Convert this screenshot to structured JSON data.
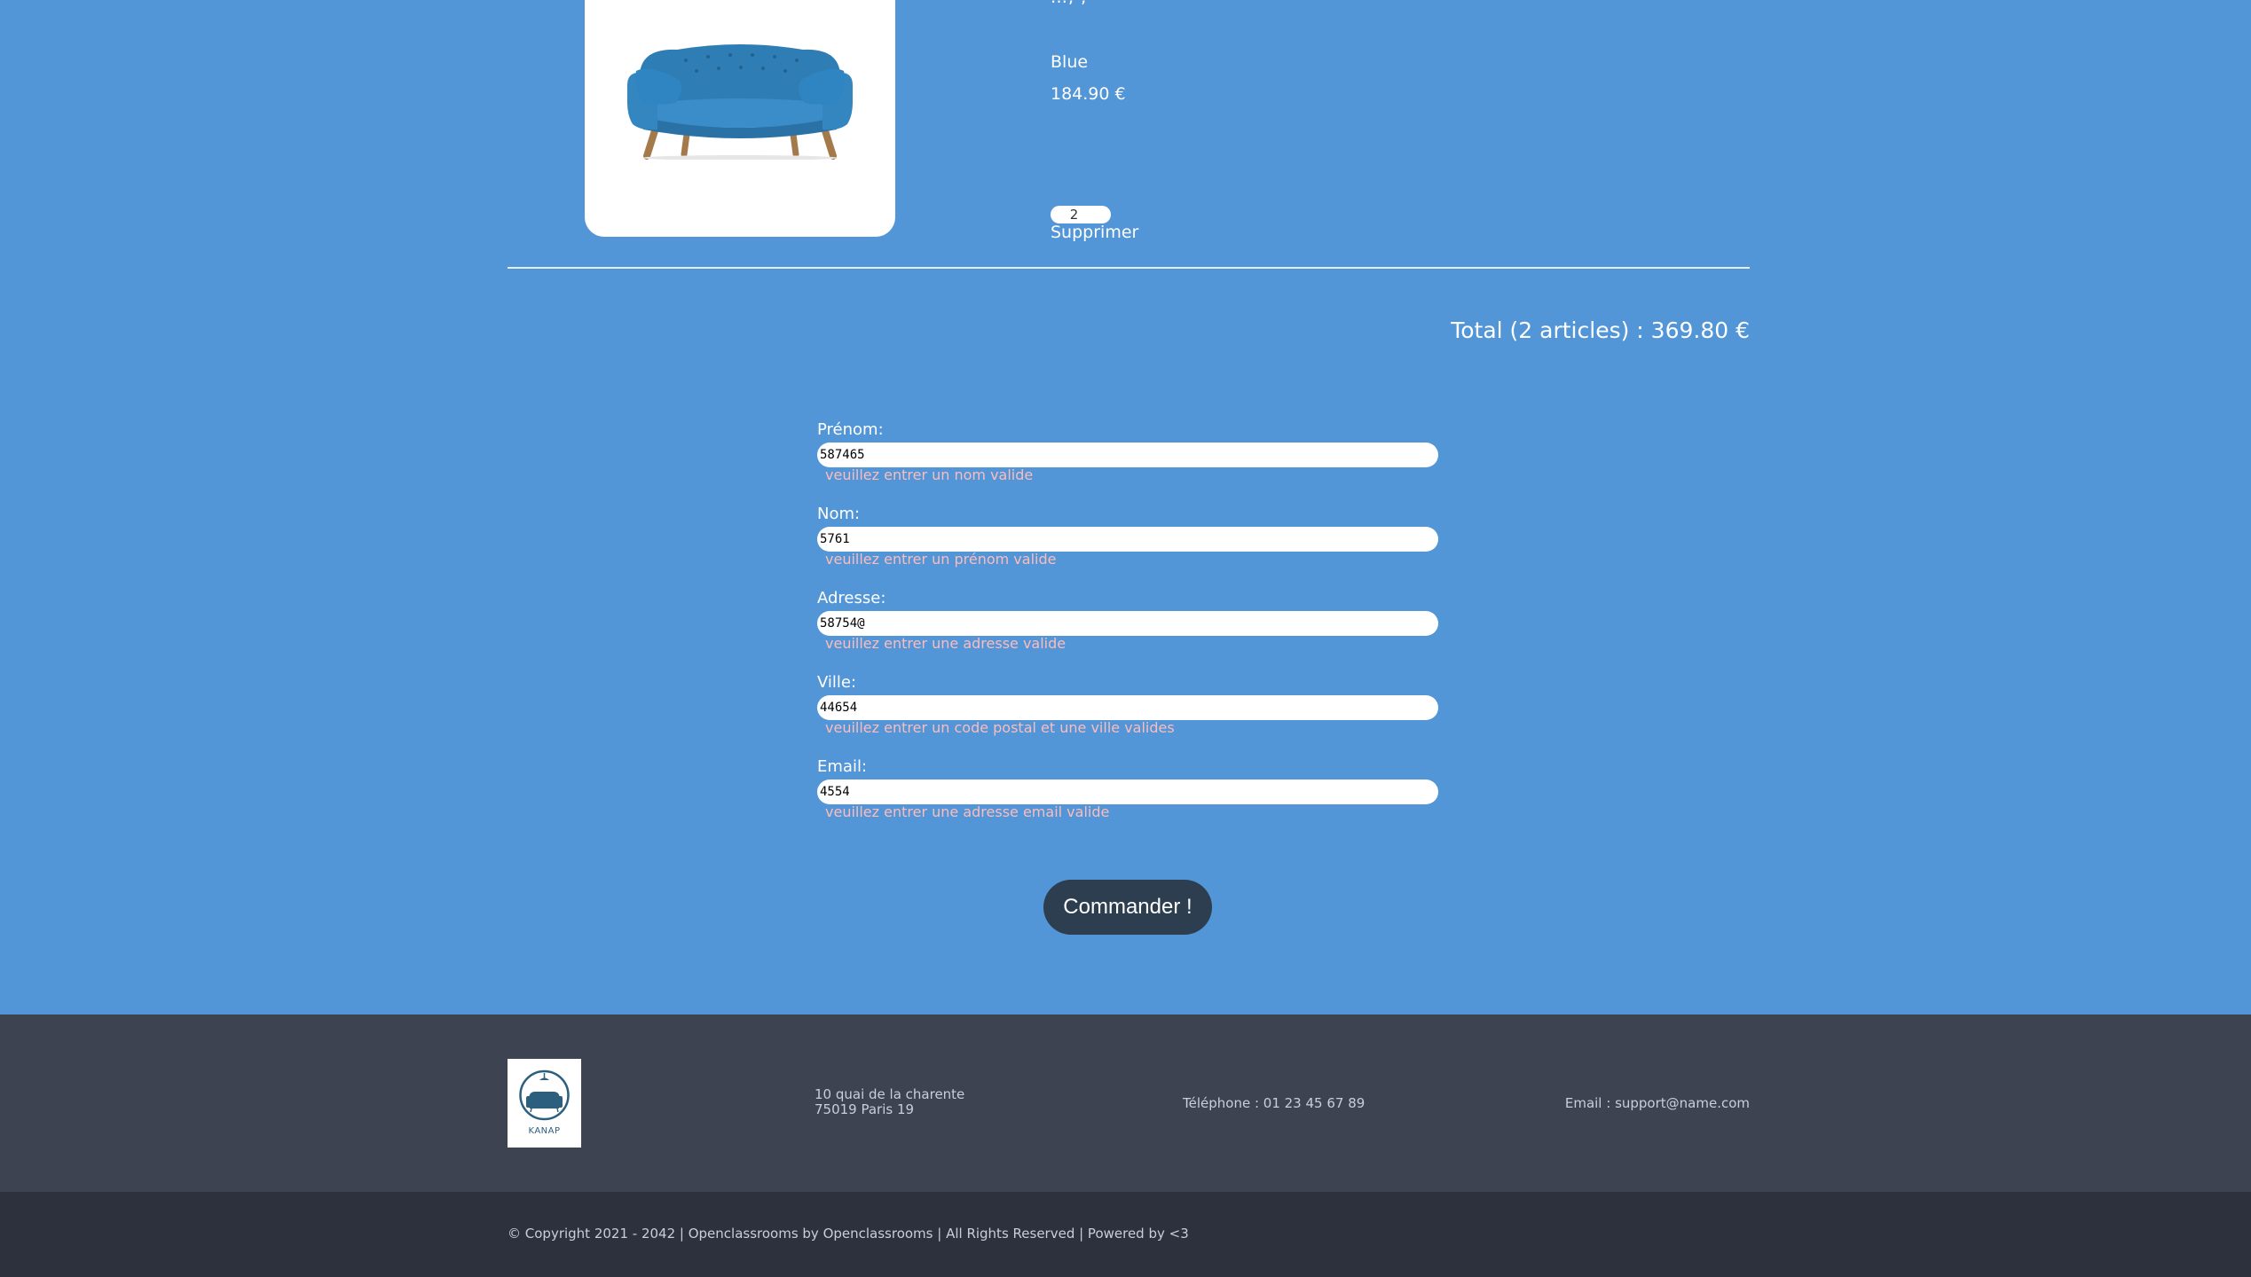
{
  "cart_item": {
    "image_alt": "Blue sofa",
    "name_cut": "…, ,",
    "color": "Blue",
    "price": "184.90 €",
    "quantity": "2",
    "delete_label": "Supprimer"
  },
  "total": {
    "text": "Total (2 articles) : 369.80 €"
  },
  "form": {
    "fields": [
      {
        "label": "Prénom:",
        "value": "587465",
        "error": "veuillez entrer un nom valide"
      },
      {
        "label": "Nom:",
        "value": "5761",
        "error": "veuillez entrer un prénom valide"
      },
      {
        "label": "Adresse:",
        "value": "58754@",
        "error": "veuillez entrer une adresse valide"
      },
      {
        "label": "Ville:",
        "value": "44654",
        "error": "veuillez entrer un code postal et une ville valides"
      },
      {
        "label": "Email:",
        "value": "4554",
        "error": "veuillez entrer une adresse email valide"
      }
    ],
    "submit_label": "Commander !"
  },
  "footer": {
    "logo_text": "KANAP",
    "address_line1": "10 quai de la charente",
    "address_line2": "75019 Paris 19",
    "phone": "Téléphone : 01 23 45 67 89",
    "email": "Email : support@name.com",
    "copyright": "© Copyright 2021 - 2042 | Openclassrooms by Openclassrooms | All Rights Reserved | Powered by <3"
  },
  "colors": {
    "background": "#5296d8",
    "footer_top": "#3d4351",
    "footer_bottom": "#2d303d",
    "button": "#2c3e50",
    "error_text": "#fbbcbc"
  }
}
